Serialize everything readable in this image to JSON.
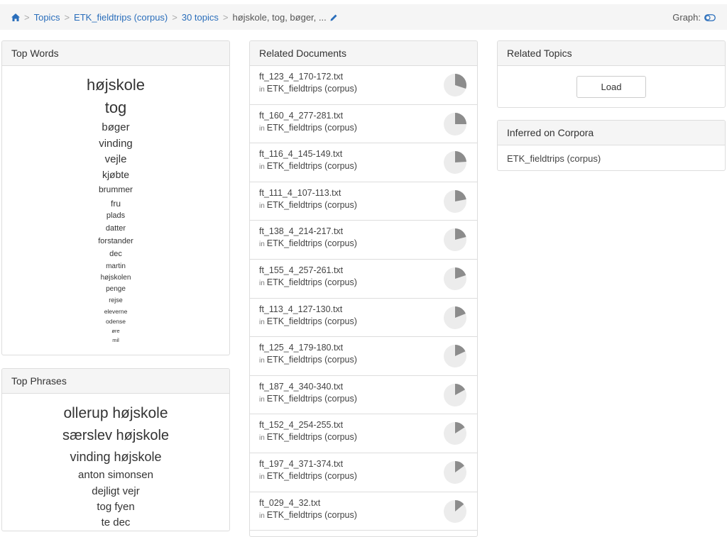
{
  "breadcrumb": {
    "home_icon": "home-icon",
    "items": [
      "Topics",
      "ETK_fieldtrips (corpus)",
      "30 topics"
    ],
    "current": "højskole, tog, bøger, ...",
    "separator": ">",
    "edit_icon": "pencil-icon"
  },
  "graph": {
    "label": "Graph:",
    "icon": "toggle-icon"
  },
  "top_words": {
    "title": "Top Words",
    "words": [
      "højskole",
      "tog",
      "bøger",
      "vinding",
      "vejle",
      "kjøbte",
      "brummer",
      "fru",
      "plads",
      "datter",
      "forstander",
      "dec",
      "martin",
      "højskolen",
      "penge",
      "rejse",
      "eleverne",
      "odense",
      "øre",
      "mil"
    ]
  },
  "top_phrases": {
    "title": "Top Phrases",
    "phrases": [
      "ollerup højskole",
      "særslev højskole",
      "vinding højskole",
      "anton simonsen",
      "dejligt vejr",
      "tog fyen",
      "te dec"
    ]
  },
  "related_documents": {
    "title": "Related Documents",
    "in_label": "in",
    "docs": [
      {
        "name": "ft_123_4_170-172.txt",
        "corpus": "ETK_fieldtrips (corpus)",
        "share": 0.3
      },
      {
        "name": "ft_160_4_277-281.txt",
        "corpus": "ETK_fieldtrips (corpus)",
        "share": 0.25
      },
      {
        "name": "ft_116_4_145-149.txt",
        "corpus": "ETK_fieldtrips (corpus)",
        "share": 0.24
      },
      {
        "name": "ft_111_4_107-113.txt",
        "corpus": "ETK_fieldtrips (corpus)",
        "share": 0.22
      },
      {
        "name": "ft_138_4_214-217.txt",
        "corpus": "ETK_fieldtrips (corpus)",
        "share": 0.21
      },
      {
        "name": "ft_155_4_257-261.txt",
        "corpus": "ETK_fieldtrips (corpus)",
        "share": 0.2
      },
      {
        "name": "ft_113_4_127-130.txt",
        "corpus": "ETK_fieldtrips (corpus)",
        "share": 0.19
      },
      {
        "name": "ft_125_4_179-180.txt",
        "corpus": "ETK_fieldtrips (corpus)",
        "share": 0.18
      },
      {
        "name": "ft_187_4_340-340.txt",
        "corpus": "ETK_fieldtrips (corpus)",
        "share": 0.17
      },
      {
        "name": "ft_152_4_254-255.txt",
        "corpus": "ETK_fieldtrips (corpus)",
        "share": 0.16
      },
      {
        "name": "ft_197_4_371-374.txt",
        "corpus": "ETK_fieldtrips (corpus)",
        "share": 0.15
      },
      {
        "name": "ft_029_4_32.txt",
        "corpus": "ETK_fieldtrips (corpus)",
        "share": 0.14
      }
    ]
  },
  "related_topics": {
    "title": "Related Topics",
    "load_label": "Load"
  },
  "inferred": {
    "title": "Inferred on Corpora",
    "corpus": "ETK_fieldtrips (corpus)"
  },
  "colors": {
    "link": "#2a6ebb",
    "pie_fill": "#8c8c8c",
    "pie_bg": "#ececec",
    "panel_heading": "#f5f5f5"
  }
}
